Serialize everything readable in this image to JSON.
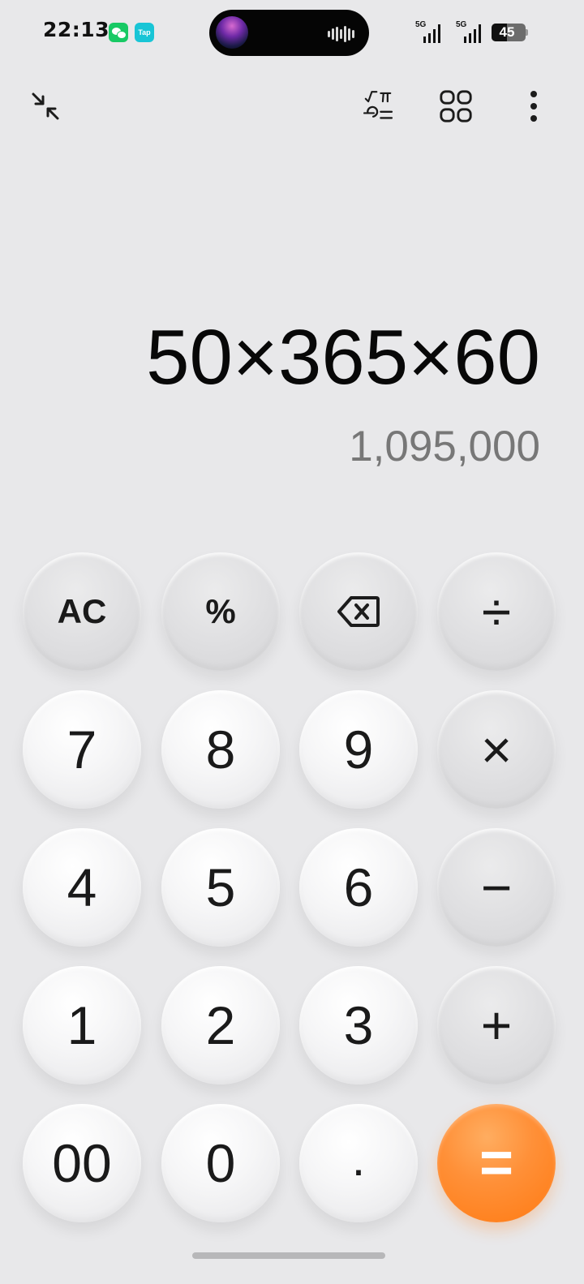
{
  "status_bar": {
    "time": "22:13",
    "apps": [
      {
        "name": "wechat-icon"
      },
      {
        "name": "tap-icon",
        "label": "Tap"
      }
    ],
    "network": [
      {
        "type": "5G"
      },
      {
        "type": "5G"
      }
    ],
    "battery_level": "45",
    "battery_percent": 45
  },
  "toolbar": {
    "icons": [
      "collapse-icon",
      "scientific-functions-icon",
      "grid-icon",
      "more-vertical-icon"
    ]
  },
  "display": {
    "expression": "50×365×60",
    "result": "1,095,000"
  },
  "keys": {
    "ac": "AC",
    "percent": "%",
    "divide": "÷",
    "seven": "7",
    "eight": "8",
    "nine": "9",
    "multiply": "×",
    "four": "4",
    "five": "5",
    "six": "6",
    "minus": "−",
    "one": "1",
    "two": "2",
    "three": "3",
    "plus": "+",
    "double_zero": "00",
    "zero": "0",
    "decimal": ".",
    "equals": "="
  },
  "colors": {
    "background": "#e8e8ea",
    "accent": "#ff7a12",
    "result_text": "#777777"
  }
}
